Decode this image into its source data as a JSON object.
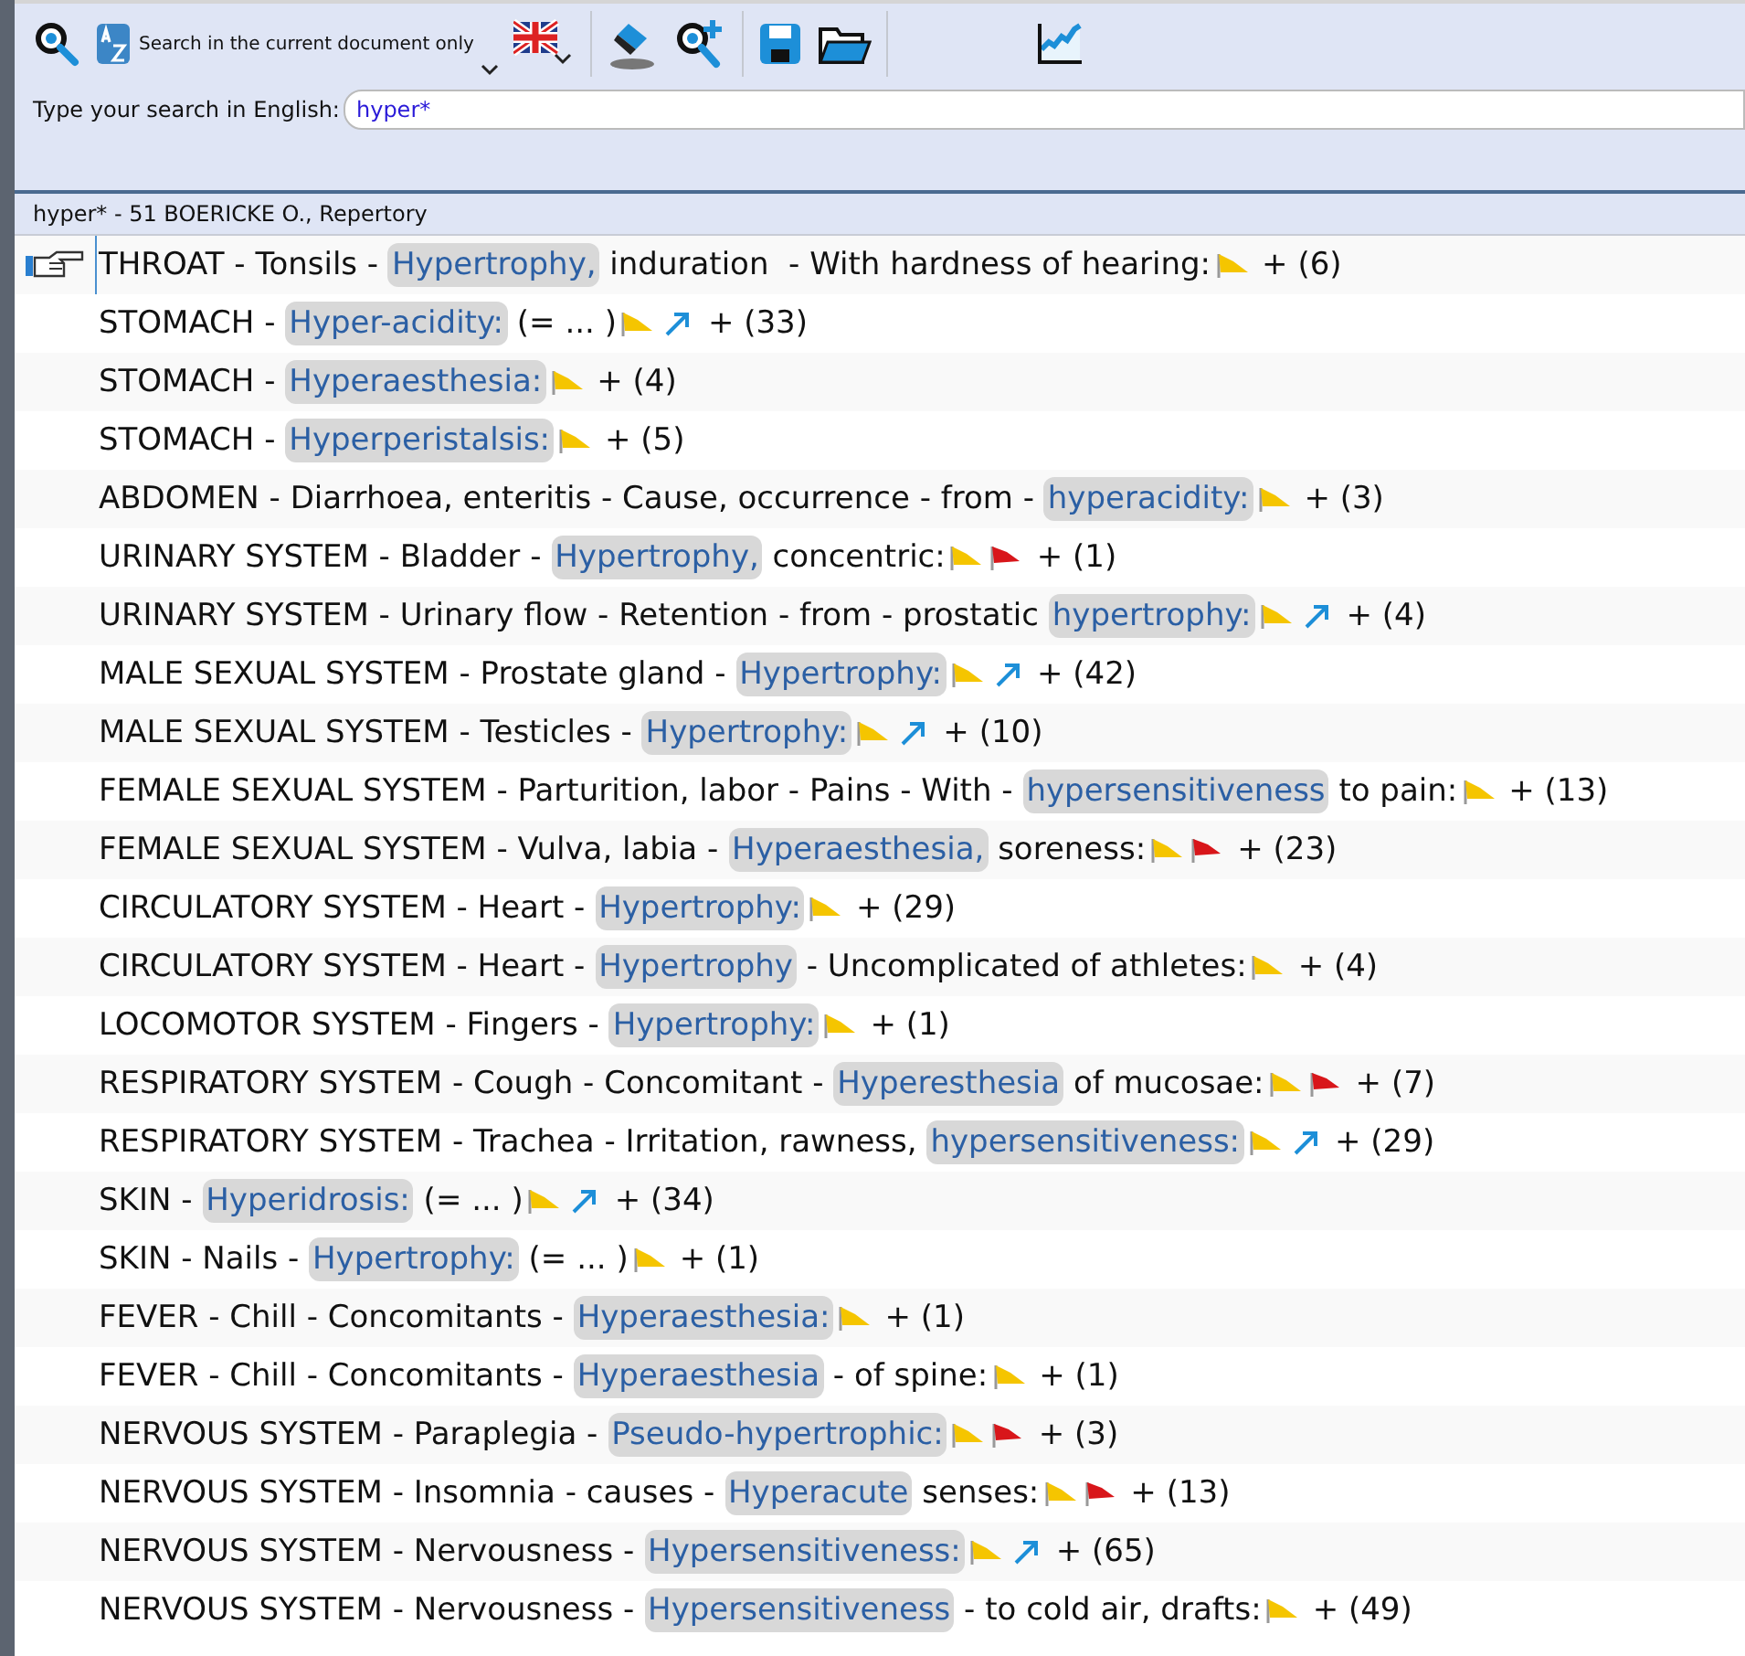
{
  "toolbar": {
    "scope_label": "Search in the current document only"
  },
  "search": {
    "label": "Type your search in English:",
    "value": "hyper*"
  },
  "results_header": "hyper* - 51 BOERICKE O., Repertory",
  "rows": [
    {
      "before": "THROAT - Tonsils - ",
      "match": "Hypertrophy,",
      "after": " induration  - With hardness of hearing:",
      "marks": [
        {
          "kind": "yellow-flag"
        }
      ],
      "count": "+ (6)",
      "selected": true
    },
    {
      "before": "STOMACH - ",
      "match": "Hyper-acidity:",
      "after": " (= ... )",
      "marks": [
        {
          "kind": "yellow-flag"
        },
        {
          "kind": "arrow"
        }
      ],
      "count": "+ (33)",
      "selected": false
    },
    {
      "before": "STOMACH - ",
      "match": "Hyperaesthesia:",
      "after": "",
      "marks": [
        {
          "kind": "yellow-flag"
        }
      ],
      "count": "+ (4)",
      "selected": false
    },
    {
      "before": "STOMACH - ",
      "match": "Hyperperistalsis:",
      "after": "",
      "marks": [
        {
          "kind": "yellow-flag"
        }
      ],
      "count": "+ (5)",
      "selected": false
    },
    {
      "before": "ABDOMEN - Diarrhoea, enteritis - Cause, occurrence - from - ",
      "match": "hyperacidity:",
      "after": "",
      "marks": [
        {
          "kind": "yellow-flag"
        }
      ],
      "count": "+ (3)",
      "selected": false
    },
    {
      "before": "URINARY SYSTEM - Bladder - ",
      "match": "Hypertrophy,",
      "after": " concentric:",
      "marks": [
        {
          "kind": "yellow-flag"
        },
        {
          "kind": "red-flag"
        }
      ],
      "count": "+ (1)",
      "selected": false
    },
    {
      "before": "URINARY SYSTEM - Urinary flow - Retention - from - prostatic ",
      "match": "hypertrophy:",
      "after": "",
      "marks": [
        {
          "kind": "yellow-flag"
        },
        {
          "kind": "arrow"
        }
      ],
      "count": "+ (4)",
      "selected": false
    },
    {
      "before": "MALE SEXUAL SYSTEM - Prostate gland - ",
      "match": "Hypertrophy:",
      "after": "",
      "marks": [
        {
          "kind": "yellow-flag"
        },
        {
          "kind": "arrow"
        }
      ],
      "count": "+ (42)",
      "selected": false
    },
    {
      "before": "MALE SEXUAL SYSTEM - Testicles - ",
      "match": "Hypertrophy:",
      "after": "",
      "marks": [
        {
          "kind": "yellow-flag"
        },
        {
          "kind": "arrow"
        }
      ],
      "count": "+ (10)",
      "selected": false
    },
    {
      "before": "FEMALE SEXUAL SYSTEM - Parturition, labor - Pains - With - ",
      "match": "hypersensitiveness",
      "after": " to pain:",
      "marks": [
        {
          "kind": "yellow-flag"
        }
      ],
      "count": "+ (13)",
      "selected": false
    },
    {
      "before": "FEMALE SEXUAL SYSTEM - Vulva, labia - ",
      "match": "Hyperaesthesia,",
      "after": " soreness:",
      "marks": [
        {
          "kind": "yellow-flag"
        },
        {
          "kind": "red-flag"
        }
      ],
      "count": "+ (23)",
      "selected": false
    },
    {
      "before": "CIRCULATORY SYSTEM - Heart - ",
      "match": "Hypertrophy:",
      "after": "",
      "marks": [
        {
          "kind": "yellow-flag"
        }
      ],
      "count": "+ (29)",
      "selected": false
    },
    {
      "before": "CIRCULATORY SYSTEM - Heart - ",
      "match": "Hypertrophy",
      "after": " - Uncomplicated of athletes:",
      "marks": [
        {
          "kind": "yellow-flag"
        }
      ],
      "count": "+ (4)",
      "selected": false
    },
    {
      "before": "LOCOMOTOR SYSTEM - Fingers - ",
      "match": "Hypertrophy:",
      "after": "",
      "marks": [
        {
          "kind": "yellow-flag"
        }
      ],
      "count": "+ (1)",
      "selected": false
    },
    {
      "before": "RESPIRATORY SYSTEM - Cough - Concomitant - ",
      "match": "Hyperesthesia",
      "after": " of mucosae:",
      "marks": [
        {
          "kind": "yellow-flag"
        },
        {
          "kind": "red-flag"
        }
      ],
      "count": "+ (7)",
      "selected": false
    },
    {
      "before": "RESPIRATORY SYSTEM - Trachea - Irritation, rawness, ",
      "match": "hypersensitiveness:",
      "after": "",
      "marks": [
        {
          "kind": "yellow-flag"
        },
        {
          "kind": "arrow"
        }
      ],
      "count": "+ (29)",
      "selected": false
    },
    {
      "before": "SKIN - ",
      "match": "Hyperidrosis:",
      "after": " (= ... )",
      "marks": [
        {
          "kind": "yellow-flag"
        },
        {
          "kind": "arrow"
        }
      ],
      "count": "+ (34)",
      "selected": false
    },
    {
      "before": "SKIN - Nails - ",
      "match": "Hypertrophy:",
      "after": " (= ... )",
      "marks": [
        {
          "kind": "yellow-flag"
        }
      ],
      "count": "+ (1)",
      "selected": false
    },
    {
      "before": "FEVER - Chill - Concomitants - ",
      "match": "Hyperaesthesia:",
      "after": "",
      "marks": [
        {
          "kind": "yellow-flag"
        }
      ],
      "count": "+ (1)",
      "selected": false
    },
    {
      "before": "FEVER - Chill - Concomitants - ",
      "match": "Hyperaesthesia",
      "after": " - of spine:",
      "marks": [
        {
          "kind": "yellow-flag"
        }
      ],
      "count": "+ (1)",
      "selected": false
    },
    {
      "before": "NERVOUS SYSTEM - Paraplegia - ",
      "match": "Pseudo-hypertrophic:",
      "after": "",
      "marks": [
        {
          "kind": "yellow-flag"
        },
        {
          "kind": "red-flag"
        }
      ],
      "count": "+ (3)",
      "selected": false
    },
    {
      "before": "NERVOUS SYSTEM - Insomnia - causes - ",
      "match": "Hyperacute",
      "after": " senses:",
      "marks": [
        {
          "kind": "yellow-flag"
        },
        {
          "kind": "red-flag"
        }
      ],
      "count": "+ (13)",
      "selected": false
    },
    {
      "before": "NERVOUS SYSTEM - Nervousness - ",
      "match": "Hypersensitiveness:",
      "after": "",
      "marks": [
        {
          "kind": "yellow-flag"
        },
        {
          "kind": "arrow"
        }
      ],
      "count": "+ (65)",
      "selected": false
    },
    {
      "before": "NERVOUS SYSTEM - Nervousness - ",
      "match": "Hypersensitiveness",
      "after": " - to cold air, drafts:",
      "marks": [
        {
          "kind": "yellow-flag"
        }
      ],
      "count": "+ (49)",
      "selected": false
    }
  ]
}
